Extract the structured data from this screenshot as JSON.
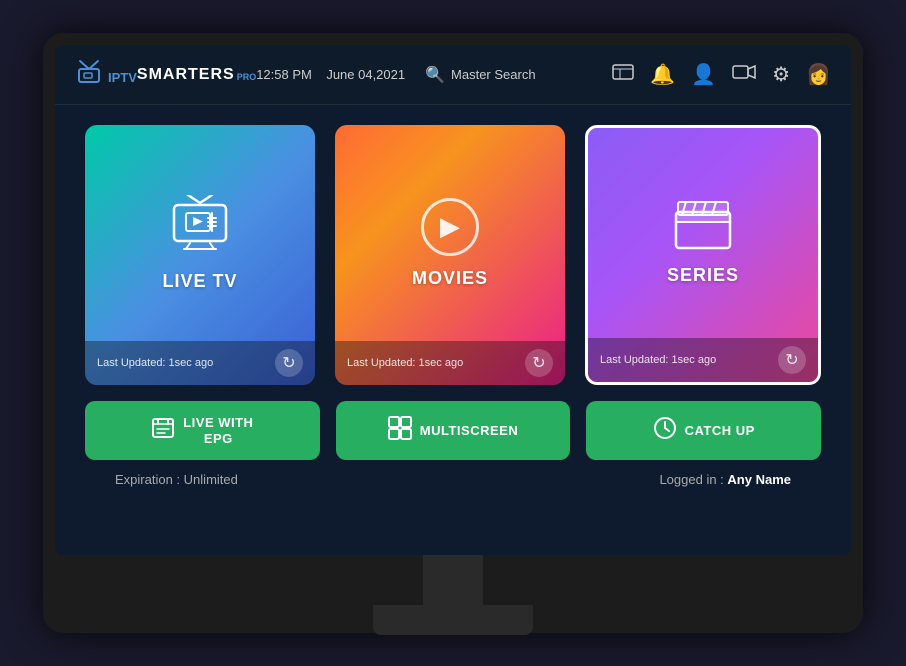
{
  "app": {
    "title": "IPTV Smarters Pro"
  },
  "header": {
    "logo_iptv": "IPTV",
    "logo_smarters": "SMARTERS",
    "logo_pro": "PRO",
    "time": "12:58 PM",
    "date": "June 04,2021",
    "search_label": "Master Search"
  },
  "cards": [
    {
      "id": "live-tv",
      "title": "LIVE TV",
      "updated": "Last Updated: 1sec ago",
      "icon": "tv"
    },
    {
      "id": "movies",
      "title": "MOVIES",
      "updated": "Last Updated: 1sec ago",
      "icon": "play"
    },
    {
      "id": "series",
      "title": "SERIES",
      "updated": "Last Updated: 1sec ago",
      "icon": "clapper"
    }
  ],
  "bottom_cards": [
    {
      "id": "live-epg",
      "label": "LIVE WITH\nEPG",
      "icon": "book"
    },
    {
      "id": "multiscreen",
      "label": "MULTISCREEN",
      "icon": "grid"
    },
    {
      "id": "catch-up",
      "label": "CATCH UP",
      "icon": "clock"
    }
  ],
  "footer": {
    "expiration_label": "Expiration :",
    "expiration_value": "Unlimited",
    "logged_in_label": "Logged in :",
    "logged_in_value": "Any Name"
  }
}
